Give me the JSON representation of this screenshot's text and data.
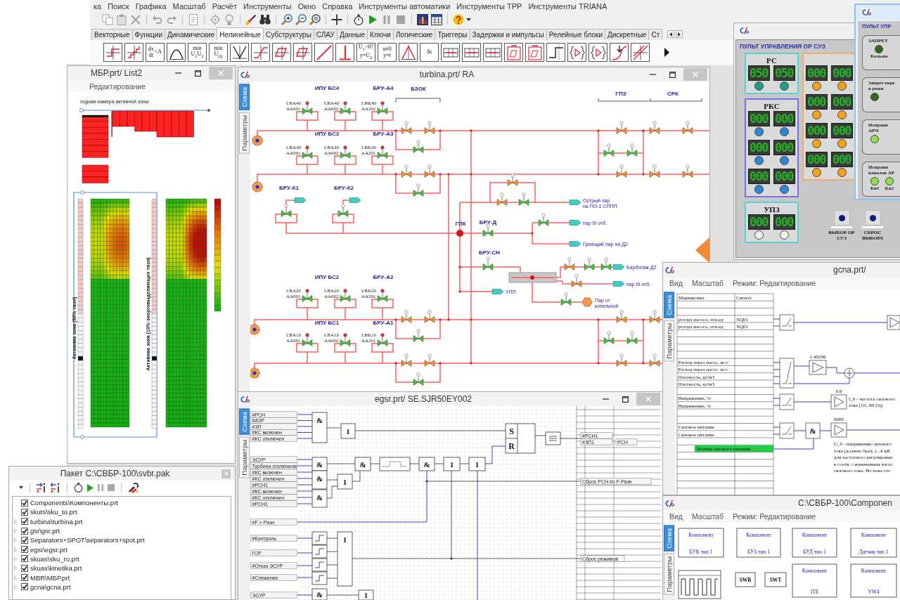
{
  "menu_bar": {
    "items": [
      "ка",
      "Поиск",
      "Графика",
      "Масштаб",
      "Расчёт",
      "Инструменты",
      "Окно",
      "Справка",
      "Инструменты автоматики",
      "Инструменты ТРР",
      "Инструменты TRIANA"
    ]
  },
  "toolbar": {
    "buttons": [
      {
        "kind": "copy",
        "disabled": true
      },
      {
        "kind": "paste",
        "disabled": true
      },
      {
        "kind": "cut",
        "disabled": true
      },
      {
        "kind": "undo",
        "disabled": true
      },
      {
        "kind": "redo",
        "disabled": true
      },
      {
        "kind": "page",
        "disabled": true
      },
      {
        "kind": "target",
        "disabled": true
      },
      {
        "kind": "bulb",
        "disabled": true
      },
      {
        "kind": "brush",
        "disabled": false
      },
      {
        "kind": "binoculars",
        "disabled": false
      },
      {
        "kind": "zoom-in",
        "disabled": false
      },
      {
        "kind": "zoom-out",
        "disabled": false
      },
      {
        "kind": "zoom-fit",
        "disabled": false
      },
      {
        "kind": "crosshair",
        "disabled": false
      },
      {
        "kind": "stopwatch",
        "disabled": false
      },
      {
        "kind": "play",
        "disabled": false
      },
      {
        "kind": "pause",
        "disabled": true
      },
      {
        "kind": "stop",
        "disabled": true
      },
      {
        "kind": "chart",
        "disabled": false
      },
      {
        "kind": "table",
        "disabled": false
      },
      {
        "kind": "help",
        "disabled": false
      }
    ]
  },
  "palette": {
    "tabs": [
      {
        "label": "Векторные",
        "selected": false
      },
      {
        "label": "Функции",
        "selected": false
      },
      {
        "label": "Динамические",
        "selected": false
      },
      {
        "label": "Нелинейные",
        "selected": true
      },
      {
        "label": "Субструктуры",
        "selected": false
      },
      {
        "label": "СЛАУ",
        "selected": false
      },
      {
        "label": "Данные",
        "selected": false
      },
      {
        "label": "Ключи",
        "selected": false
      },
      {
        "label": "Логические",
        "selected": false
      },
      {
        "label": "Триггеры",
        "selected": false
      },
      {
        "label": "Задержки и импульсы",
        "selected": false
      },
      {
        "label": "Релейные блоки",
        "selected": false
      },
      {
        "label": "Дискретные",
        "selected": false
      },
      {
        "label": "Ст",
        "selected": false
      }
    ],
    "blocks": [
      {
        "kind": "relay"
      },
      {
        "kind": "steps"
      },
      {
        "kind": "text",
        "lines": [
          "dx",
          "dt"
        ],
        "suffix": "<A"
      },
      {
        "kind": "arc"
      },
      {
        "kind": "text",
        "lines": [
          "min",
          "U$_{1}$U$_{2}$"
        ]
      },
      {
        "kind": "text",
        "lines": [
          "min",
          "U$_{(i)}$"
        ]
      },
      {
        "kind": "abs"
      },
      {
        "kind": "sat"
      },
      {
        "kind": "hyst"
      },
      {
        "kind": "hyst"
      },
      {
        "kind": "line"
      },
      {
        "kind": "impulse"
      },
      {
        "kind": "text",
        "lines": [
          "U$_{1}$>0?",
          "y=U$_{2}$"
        ]
      },
      {
        "kind": "text",
        "lines": [
          "u≠0",
          "y=t"
        ]
      },
      {
        "kind": "triangle"
      },
      {
        "kind": "text",
        "lines": [
          "Δt"
        ]
      },
      {
        "kind": "table"
      },
      {
        "kind": "table"
      },
      {
        "kind": "table"
      },
      {
        "kind": "boxhyst"
      },
      {
        "kind": "boxhyst"
      },
      {
        "kind": "step"
      },
      {
        "kind": "brace"
      },
      {
        "kind": "brace"
      },
      {
        "kind": "arrowcurve"
      },
      {
        "kind": "crosscurve"
      }
    ]
  },
  "mbr_window": {
    "title": "МБР.prt/ List2",
    "mode": "Редактирование",
    "caption": "ходная камера активной зоны",
    "core_labels": [
      "Активная зона (90% твэл)",
      "Активная зона (10% энерговыделяющих твэл)"
    ]
  },
  "package_window": {
    "title": "Пакет C:\\СВБР-100\\svbr.pak",
    "files": [
      {
        "name": "Components\\Компоненты.prt",
        "checked": true,
        "expandable": false
      },
      {
        "name": "skuts\\sku_to.prt",
        "checked": true,
        "expandable": false
      },
      {
        "name": "turbina\\turbina.prt",
        "checked": true,
        "expandable": true
      },
      {
        "name": "gsr\\gsr.prt",
        "checked": true,
        "expandable": true
      },
      {
        "name": "Separators+SPOT\\separators+spot.prt",
        "checked": true,
        "expandable": true
      },
      {
        "name": "egsr\\egsr.prt",
        "checked": true,
        "expandable": true
      },
      {
        "name": "skuas\\sku_ro.prt",
        "checked": true,
        "expandable": true
      },
      {
        "name": "skuas\\kinetika.prt",
        "checked": true,
        "expandable": true
      },
      {
        "name": "MBR\\МБР.prt",
        "checked": true,
        "expandable": true
      },
      {
        "name": "gcna\\gcna.prt",
        "checked": true,
        "expandable": true
      }
    ]
  },
  "turbina_window": {
    "title": "turbina.prt/ RA",
    "side_tabs": [
      {
        "label": "Схема",
        "selected": true
      },
      {
        "label": "Параметры",
        "selected": false
      }
    ],
    "safety_rows": [
      {
        "ipu": "ИПУ БС4",
        "bru": "БРУ-А4",
        "valves": [
          {
            "tag": "LBA40",
            "code": "AA001",
            "open": true
          },
          {
            "tag": "LBA40",
            "code": "AA002",
            "open": true
          },
          {
            "tag": "LBK40",
            "code": "AA201",
            "open": true
          }
        ]
      },
      {
        "ipu": "ИПУ БС3",
        "bru": "БРУ-А3",
        "valves": [
          {
            "tag": "LBA30",
            "code": "AA001",
            "open": true
          },
          {
            "tag": "LBA30",
            "code": "AA002",
            "open": true
          },
          {
            "tag": "LBK30",
            "code": "AA201",
            "open": true
          }
        ]
      },
      {
        "ipu": "ИПУ БС2",
        "bru": "БРУ-А2",
        "valves": [
          {
            "tag": "LBA20",
            "code": "AA001",
            "open": true
          },
          {
            "tag": "LBA20",
            "code": "AA002",
            "open": true
          },
          {
            "tag": "LBK20",
            "code": "AA201",
            "open": true
          }
        ]
      },
      {
        "ipu": "ИПУ БС1",
        "bru": "БРУ-А1",
        "valves": [
          {
            "tag": "LBA10",
            "code": "AA001",
            "open": true
          },
          {
            "tag": "LBA10",
            "code": "AA002",
            "open": true
          },
          {
            "tag": "LBK10",
            "code": "AA201",
            "open": true
          }
        ]
      }
    ],
    "labels": [
      "БЗОК",
      "ГПЗ",
      "СРК",
      "БРУ-К1",
      "БРУ-К2",
      "ГПК",
      "БРУ-Д",
      "БРУ-СН"
    ],
    "outlets": [
      {
        "kind": "tag",
        "lines": [
          "Острый пар",
          "на ПО-1 СППП"
        ]
      },
      {
        "kind": "tag",
        "lines": [
          "пар III отб."
        ]
      },
      {
        "kind": "tag",
        "lines": [
          "Греющий пар на Д2"
        ]
      },
      {
        "kind": "tag",
        "lines": [
          "Барботаж Д2"
        ]
      },
      {
        "kind": "tag",
        "lines": [
          "пар III отб."
        ]
      },
      {
        "kind": "tag",
        "lines": [
          "УПП"
        ]
      },
      {
        "kind": "source",
        "lines": [
          "Пар от",
          "котельной"
        ]
      },
      {
        "kind": "tag"
      },
      {
        "kind": "tag"
      }
    ],
    "valves": [
      {
        "open": false
      },
      {
        "open": false
      },
      {
        "open": true
      },
      {
        "open": false
      },
      {
        "open": false
      },
      {
        "open": true
      },
      {
        "open": false
      },
      {
        "open": false
      },
      {
        "open": true
      },
      {
        "open": false
      },
      {
        "open": false
      },
      {
        "open": true
      },
      {
        "open": false
      },
      {
        "open": false
      },
      {
        "open": false
      },
      {
        "open": false
      },
      {
        "open": false
      },
      {
        "open": false
      },
      {
        "open": true
      },
      {
        "open": true
      },
      {
        "open": false
      },
      {
        "open": false
      },
      {
        "open": false
      },
      {
        "open": false
      },
      {
        "open": true
      },
      {
        "open": true
      },
      {
        "open": true
      },
      {
        "open": true
      },
      {
        "open": false
      },
      {
        "open": false
      },
      {
        "open": true
      },
      {
        "open": true
      },
      {
        "open": true
      },
      {
        "open": true
      },
      {
        "open": false
      },
      {
        "open": true
      },
      {
        "open": true
      },
      {
        "open": false
      },
      {
        "open": true
      }
    ]
  },
  "egsr_window": {
    "title": "egsr.prt/ SE.SJR50EY002",
    "side_tabs": [
      {
        "label": "Схема",
        "selected": true
      },
      {
        "label": "Параметры",
        "selected": false
      }
    ],
    "inputs": [
      "#РСН",
      "#АЗР",
      "#ЗП",
      "#КС включен",
      "#КС отключен",
      "ЭСУР",
      "Турбина отключена",
      "#КС включен",
      "#КС отключен",
      "#РСН1",
      "#КС включен",
      "#КС отключен",
      "#РСН1",
      "#F > Pазн",
      "#Контроль",
      "ГСР",
      "#Отказ ЭСУР",
      "#Слежение",
      "ЭСУР"
    ],
    "gates": [
      {
        "kind": "gate",
        "symbol": "&"
      },
      {
        "kind": "gate",
        "symbol": "1"
      },
      {
        "kind": "sr",
        "symbols": [
          "S",
          "R"
        ]
      },
      {
        "kind": "compare"
      },
      {
        "kind": "gate",
        "symbol": "&"
      },
      {
        "kind": "gate",
        "symbol": "&"
      },
      {
        "kind": "delay"
      },
      {
        "kind": "gate",
        "symbol": "&"
      },
      {
        "kind": "gate",
        "symbol": "1"
      },
      {
        "kind": "gate",
        "symbol": "1"
      },
      {
        "kind": "gate",
        "symbol": "&"
      },
      {
        "kind": "gate",
        "symbol": "1"
      },
      {
        "kind": "gate",
        "symbol": "&"
      },
      {
        "kind": "threshold"
      },
      {
        "kind": "threshold"
      },
      {
        "kind": "threshold"
      },
      {
        "kind": "threshold"
      },
      {
        "kind": "gate",
        "symbol": "1"
      },
      {
        "kind": "gate",
        "symbol": "&"
      },
      {
        "kind": "gate",
        "symbol": "1"
      }
    ],
    "outputs": [
      "#РСН1",
      "#ЗП1",
      "РСН",
      "Сброс РСН по F-Pазн",
      "Сброс режимов"
    ]
  },
  "gcna_window": {
    "title": "gcna.prt/",
    "menu": [
      "Вид",
      "Масштаб",
      "Режим: Редактирование"
    ],
    "side_tabs": [
      {
        "label": "Схема",
        "selected": true
      },
      {
        "label": "Параметры",
        "selected": false
      }
    ],
    "table": {
      "columns": [
        "Маркировка",
        "Сигнал"
      ],
      "rows": [
        {
          "label": "ротора насоса, отн.ед",
          "signal": "XQ01"
        },
        {
          "label": "ротора насоса, отн.ед",
          "signal": "XQ01"
        },
        {
          "label": "Расход через насос, кг/с"
        },
        {
          "label": "Расход через насос, кг/с"
        },
        {
          "label": "Плотность, кг/м3"
        },
        {
          "label": "Плотность, кг/м3"
        },
        {
          "label": "Напряжение, %"
        },
        {
          "label": "Напряжение, %"
        },
        {
          "label": "Силовое питание"
        },
        {
          "label": "Силовое питание"
        }
      ],
      "alarm": "Потеря силового питания"
    },
    "gains": [
      "1.40296",
      "0.6",
      "6000"
    ],
    "gates": [
      "&"
    ],
    "notes": [
      [
        "f_0 - частота силового",
        "тока (10...80 Гц)"
      ],
      [
        "U_0 - напряжение силового",
        "тока (должно быть 1...6 кВ",
        "для частотного регулирован",
        "в соотв. с изменением часто",
        "силового тока. Но пока это"
      ]
    ]
  },
  "components_window": {
    "title": "C:\\СВБР-100\\Componen",
    "menu": [
      "Вид",
      "Масштаб",
      "Режим: Редактирование"
    ],
    "side_tabs": [
      {
        "label": "Схема",
        "selected": true
      },
      {
        "label": "Параметры",
        "selected": false
      }
    ],
    "blocks": [
      {
        "kind": "component",
        "lines": [
          "Компонент",
          "БУК тип 1"
        ]
      },
      {
        "kind": "component",
        "lines": [
          "Компонент",
          "БУЗ тип 1"
        ]
      },
      {
        "kind": "component",
        "lines": [
          "Компонент",
          "БУД тип 1"
        ]
      },
      {
        "kind": "component",
        "lines": [
          "Компонент",
          "Датчик тип 1"
        ]
      },
      {
        "kind": "pulse"
      },
      {
        "kind": "switch",
        "lines": [
          "SWB"
        ]
      },
      {
        "kind": "switch",
        "lines": [
          "SWT"
        ]
      },
      {
        "kind": "component",
        "lines": [
          "Компонент",
          "ITE"
        ]
      },
      {
        "kind": "component",
        "lines": [
          "Компонент",
          "VW4"
        ]
      }
    ]
  },
  "control_panel": {
    "header": "ПУЛЬТ УПРАВЛЕНИЯ ОР СУЗ",
    "groups": [
      {
        "title": "РС",
        "color": "#5ad2d2",
        "displays": [
          {
            "value": "050",
            "color": "#1f9e8c"
          },
          {
            "value": "050",
            "color": "#1f9e8c"
          }
        ]
      },
      {
        "title": "РКС",
        "color": "#7b6fe8",
        "displays": [
          {
            "value": "000",
            "color": "#2f86d8"
          },
          {
            "value": "000",
            "color": "#2f86d8"
          },
          {
            "value": "000",
            "color": "#2f86d8"
          },
          {
            "value": "000",
            "color": "#2f86d8"
          },
          {
            "value": "000",
            "color": "#2f86d8"
          },
          {
            "value": "000",
            "color": "#2f86d8"
          }
        ]
      },
      {
        "color": "#f2ad6b",
        "displays": [
          {
            "value": "000",
            "color": "#f2a31c"
          },
          {
            "value": "000",
            "color": "#f2a31c"
          },
          {
            "value": "000",
            "color": "#f2a31c"
          },
          {
            "value": "000",
            "color": "#f2a31c"
          },
          {
            "value": "000",
            "color": "#f2a31c"
          },
          {
            "value": "000",
            "color": "#f2a31c"
          },
          {
            "value": "000",
            "color": "#f2a31c"
          },
          {
            "value": "000",
            "color": "#f2a31c"
          }
        ]
      },
      {
        "title": "УПЗ",
        "color": "#5ad2d2",
        "displays": [
          {
            "value": "000",
            "color": "#f2f2f2"
          },
          {
            "value": "000",
            "color": "#f2f2f2"
          }
        ]
      }
    ],
    "buttons": [
      {
        "label": "ВЫБОР ОР СУЗ"
      },
      {
        "label": "СБРОС ВЫБОРА"
      }
    ]
  },
  "control_panel_2": {
    "header": "ПУЛЬТ УПР",
    "groups": [
      {
        "title": [
          "ЗАПРЕТ"
        ],
        "lamps": [
          {
            "label": "Больше",
            "on": false
          }
        ]
      },
      {
        "title": [
          "Запрет пере",
          "в режи"
        ],
        "lamps": [
          {
            "on": false
          }
        ]
      },
      {
        "title": [
          "Исправн",
          "АРЧ"
        ],
        "lamps": [
          {
            "on": true
          }
        ]
      },
      {
        "title": [
          "Исправн",
          "каналов АР"
        ],
        "lamps": [
          {
            "label": "Кн1",
            "on": true
          },
          {
            "label": "Кн2",
            "on": true
          }
        ]
      }
    ]
  }
}
